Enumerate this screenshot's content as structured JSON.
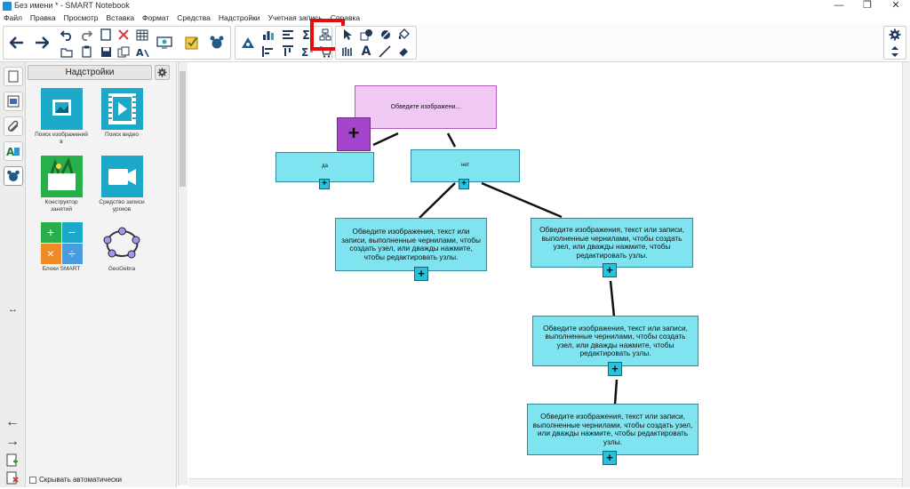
{
  "window": {
    "title": "Без имени * - SMART Notebook",
    "controls": {
      "minimize": "—",
      "maximize": "❐",
      "close": "✕"
    }
  },
  "menu": [
    "Файл",
    "Правка",
    "Просмотр",
    "Вставка",
    "Формат",
    "Средства",
    "Надстройки",
    "Учетная запись",
    "Справка"
  ],
  "toolbar": {
    "icons": [
      "back-arrow-icon",
      "forward-arrow-icon",
      "undo-icon",
      "redo-icon",
      "delete-icon",
      "table-icon",
      "save-icon",
      "paste-icon",
      "screen-icon",
      "response-icon",
      "addons-icon",
      "lab-icon",
      "chart-icon",
      "align-icon",
      "sum-icon",
      "concept-map-icon",
      "select-icon",
      "shape-icon",
      "eraser-icon",
      "fill-icon",
      "text-icon",
      "line-icon",
      "pen-icon",
      "settings-gear-icon",
      "expand-icon"
    ],
    "text_tool_label": "A",
    "highlighted_tool": "concept-map-icon"
  },
  "side_panel": {
    "header": "Надстройки",
    "addons": [
      {
        "label": "Поиск изображений в",
        "icon": "image-search-icon",
        "color": "#1ba8c9"
      },
      {
        "label": "Поиск видео",
        "icon": "video-search-icon",
        "color": "#1ba8c9"
      },
      {
        "label": "Конструктор занятий",
        "icon": "lesson-builder-icon",
        "color": "#27b04a"
      },
      {
        "label": "Средство записи уроков",
        "icon": "lesson-recorder-icon",
        "color": "#1ba8c9"
      },
      {
        "label": "Блоки SMART",
        "icon": "smart-blocks-icon",
        "color": "#27b04a"
      },
      {
        "label": "GeoGebra",
        "icon": "geogebra-icon",
        "color": "#ffffff"
      }
    ],
    "blocks_symbols": [
      "+",
      "−",
      "×",
      "÷"
    ],
    "autohide_label": "Скрывать автоматически",
    "resize_glyph": "↔"
  },
  "left_tabs": [
    "page-sorter-icon",
    "gallery-icon",
    "attachments-icon",
    "properties-icon",
    "addons-tab-icon"
  ],
  "left_nav": {
    "prev": "←",
    "next": "→"
  },
  "concept_map": {
    "root": "Обведите изображени...",
    "yes": "да",
    "no": "нет",
    "node_text": "Обведите изображения, текст или записи, выполненные чернилами, чтобы создать узел, или дважды нажмите, чтобы редактировать узлы.",
    "plus": "+"
  }
}
